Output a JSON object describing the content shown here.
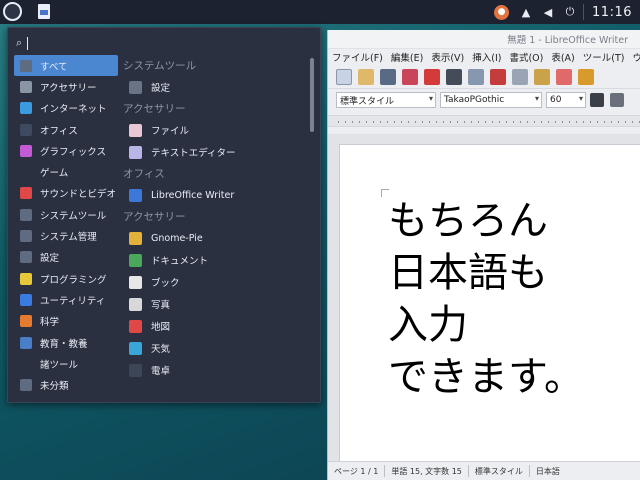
{
  "panel": {
    "clock": "11:16"
  },
  "search": {
    "placeholder": ""
  },
  "categories": [
    {
      "label": "すべて",
      "color": "#5f6b80",
      "active": true
    },
    {
      "label": "アクセサリー",
      "color": "#8a95a6"
    },
    {
      "label": "インターネット",
      "color": "#3a9be0"
    },
    {
      "label": "オフィス",
      "color": "#3d4a60"
    },
    {
      "label": "グラフィックス",
      "color": "#c45bd6"
    },
    {
      "label": "ゲーム",
      "color": "#2a3040"
    },
    {
      "label": "サウンドとビデオ",
      "color": "#e04848"
    },
    {
      "label": "システムツール",
      "color": "#5f6b80"
    },
    {
      "label": "システム管理",
      "color": "#5f6b80"
    },
    {
      "label": "設定",
      "color": "#5f6b80"
    },
    {
      "label": "プログラミング",
      "color": "#e6c93a"
    },
    {
      "label": "ユーティリティ",
      "color": "#3a7be0"
    },
    {
      "label": "科学",
      "color": "#e67a2e"
    },
    {
      "label": "教育・教養",
      "color": "#4a7ec9"
    },
    {
      "label": "諸ツール",
      "color": "#2a3040"
    },
    {
      "label": "未分類",
      "color": "#5f6b80"
    }
  ],
  "apps": [
    {
      "section": "システムツール"
    },
    {
      "label": "設定",
      "color": "#6a7385"
    },
    {
      "section": "アクセサリー"
    },
    {
      "label": "ファイル",
      "color": "#e9c7d4"
    },
    {
      "label": "テキストエディター",
      "color": "#b9b5e6"
    },
    {
      "section": "オフィス"
    },
    {
      "label": "LibreOffice Writer",
      "color": "#3b78d8"
    },
    {
      "section": "アクセサリー"
    },
    {
      "label": "Gnome-Pie",
      "color": "#e2b23a"
    },
    {
      "label": "ドキュメント",
      "color": "#49a85a"
    },
    {
      "label": "ブック",
      "color": "#e7e7e7"
    },
    {
      "label": "写真",
      "color": "#d8d8d8"
    },
    {
      "label": "地図",
      "color": "#e04848"
    },
    {
      "label": "天気",
      "color": "#3aa6d8"
    },
    {
      "label": "電卓",
      "color": "#3d4656"
    }
  ],
  "writer": {
    "title": "無題 1 - LibreOffice Writer",
    "menu": [
      "ファイル(F)",
      "編集(E)",
      "表示(V)",
      "挿入(I)",
      "書式(O)",
      "表(A)",
      "ツール(T)",
      "ウ"
    ],
    "style": "標準スタイル",
    "font": "TakaoPGothic",
    "size": "60",
    "doc_lines": [
      "もちろん",
      "日本語も",
      "入力",
      "できます。"
    ],
    "status": [
      "ページ 1 / 1",
      "単語 15, 文字数 15",
      "標準スタイル",
      "日本語"
    ]
  }
}
